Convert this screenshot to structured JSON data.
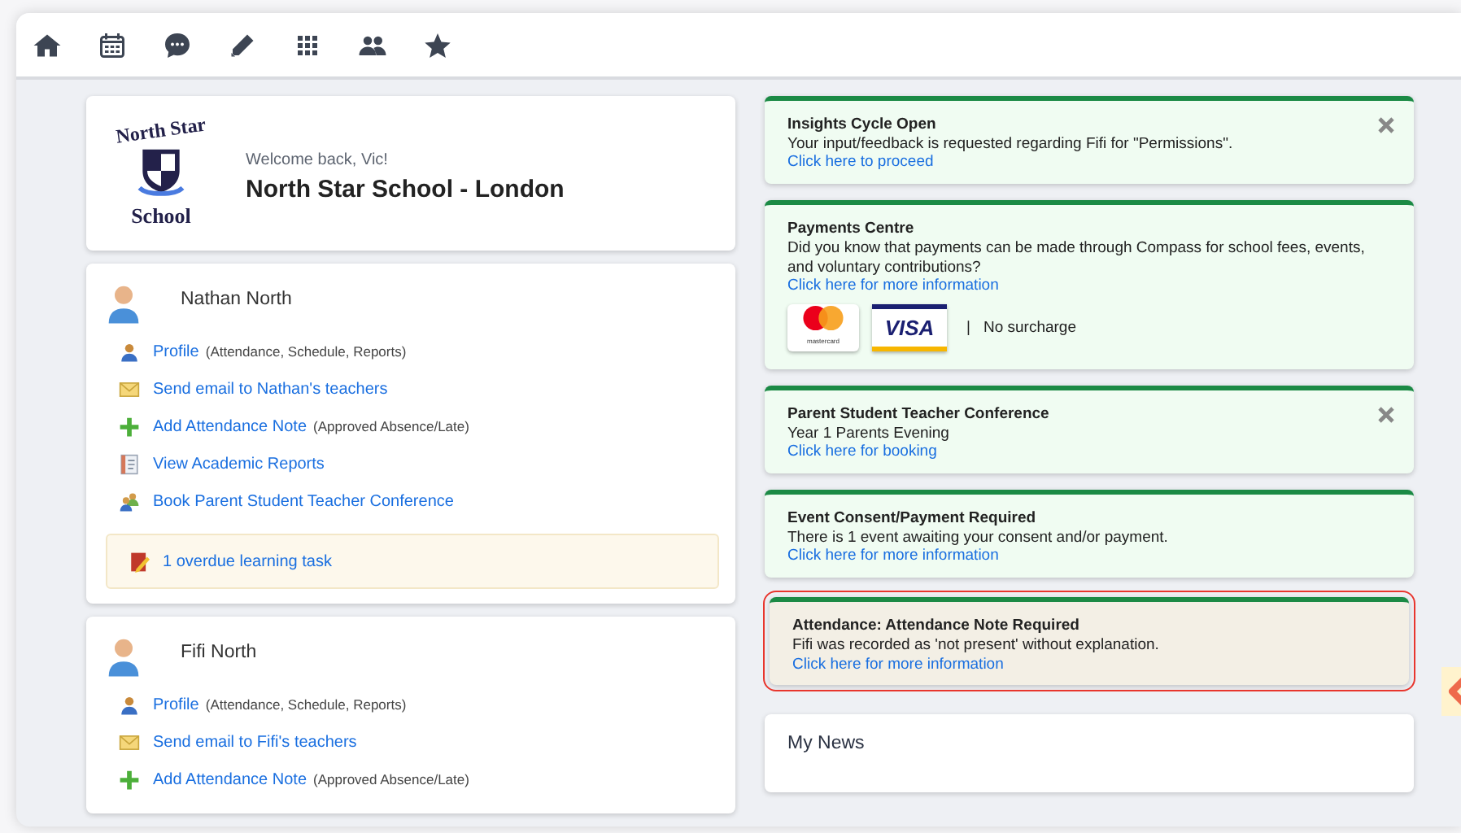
{
  "school": {
    "logo_top": "North Star",
    "logo_bottom": "School",
    "welcome": "Welcome back, Vic!",
    "name": "North Star School - London"
  },
  "students": [
    {
      "name": "Nathan North",
      "links": [
        {
          "kind": "profile",
          "label": "Profile",
          "note": "(Attendance, Schedule, Reports)"
        },
        {
          "kind": "email",
          "label": "Send email to Nathan's teachers"
        },
        {
          "kind": "add",
          "label": "Add Attendance Note",
          "note": "(Approved Absence/Late)"
        },
        {
          "kind": "reports",
          "label": "View Academic Reports"
        },
        {
          "kind": "conference",
          "label": "Book Parent Student Teacher Conference"
        }
      ],
      "alert": "1 overdue learning task"
    },
    {
      "name": "Fifi North",
      "links": [
        {
          "kind": "profile",
          "label": "Profile",
          "note": "(Attendance, Schedule, Reports)"
        },
        {
          "kind": "email",
          "label": "Send email to Fifi's teachers"
        },
        {
          "kind": "add",
          "label": "Add Attendance Note",
          "note": "(Approved Absence/Late)"
        }
      ]
    }
  ],
  "notices": [
    {
      "title": "Insights Cycle Open",
      "body": "Your input/feedback is requested regarding Fifi for \"Permissions\".",
      "link": "Click here to proceed",
      "closable": true,
      "highlighted": false
    },
    {
      "title": "Payments Centre",
      "body": "Did you know that payments can be made through Compass for school fees, events, and voluntary contributions?",
      "link": "Click here for more information",
      "closable": false,
      "highlighted": false,
      "payment": {
        "mastercard": "mastercard",
        "visa": "VISA",
        "separator": "|",
        "note": "No surcharge"
      }
    },
    {
      "title": "Parent Student Teacher Conference",
      "body": "Year 1 Parents Evening",
      "link": "Click here for booking",
      "closable": true,
      "highlighted": false
    },
    {
      "title": "Event Consent/Payment Required",
      "body": "There is 1 event awaiting your consent and/or payment.",
      "link": "Click here for more information",
      "closable": false,
      "highlighted": false
    },
    {
      "title": "Attendance: Attendance Note Required",
      "body": "Fifi was recorded as 'not present' without explanation.",
      "link": "Click here for more information",
      "closable": false,
      "highlighted": true
    }
  ],
  "news": {
    "title": "My News"
  }
}
